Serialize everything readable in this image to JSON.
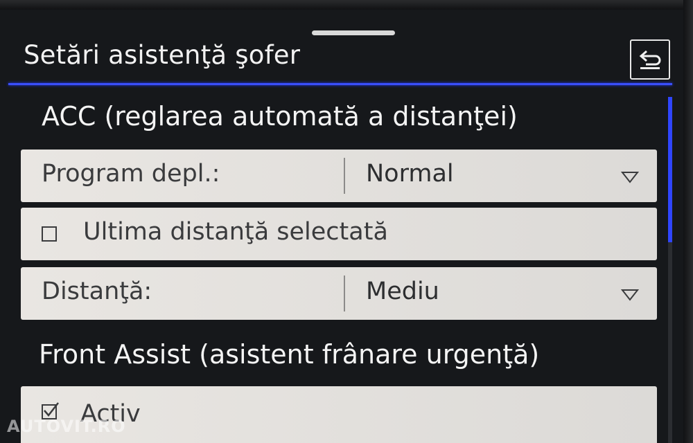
{
  "header": {
    "title": "Setări asistenţă şofer",
    "back_icon": "back-arrow-icon"
  },
  "acc_section": {
    "heading": "ACC (reglarea automată a distanţei)",
    "drive_program": {
      "label": "Program depl.:",
      "value": "Normal"
    },
    "last_distance": {
      "label": "Ultima distanţă selectată",
      "checked": false
    },
    "distance": {
      "label": "Distanţă:",
      "value": "Mediu"
    }
  },
  "front_assist_section": {
    "heading": "Front Assist (asistent frânare urgenţă)",
    "active": {
      "label": "Activ",
      "checked": true
    }
  },
  "colors": {
    "accent": "#3a4fff",
    "background": "#16181b",
    "row_background": "#e4e2df",
    "text_light": "#f2f2f2",
    "text_dark": "#3a3b3d"
  },
  "scroll": {
    "visible_fraction": 0.42,
    "position_fraction": 0.0
  },
  "watermark": "AUTOVIT.RO"
}
